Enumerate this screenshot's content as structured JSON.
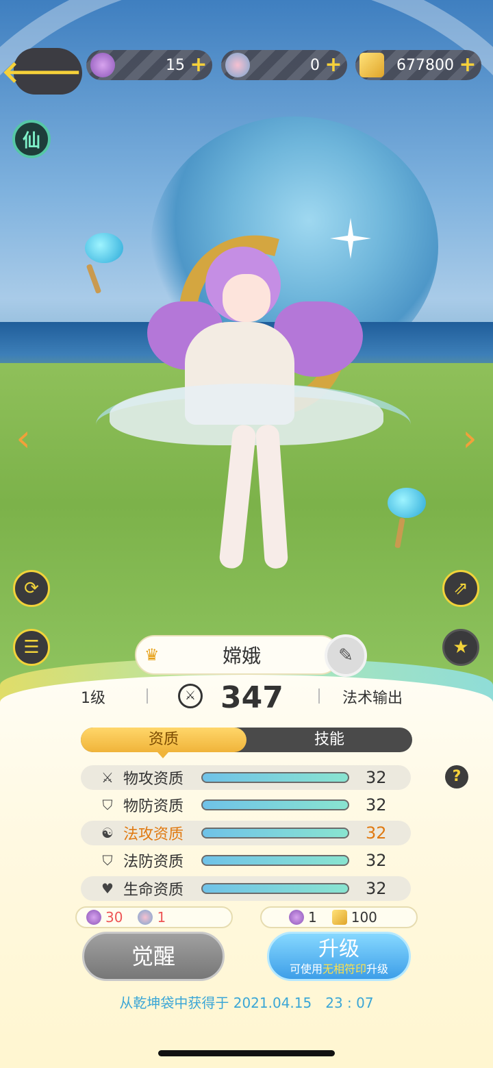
{
  "resources": [
    {
      "icon": "purple-character-icon",
      "value": "15"
    },
    {
      "icon": "gem-orb-icon",
      "value": "0"
    },
    {
      "icon": "gold-ingot-icon",
      "value": "677800"
    }
  ],
  "side": {
    "xian_label": "仙"
  },
  "character": {
    "name": "嫦娥",
    "level": "1级",
    "power": "347",
    "role": "法术输出"
  },
  "tabs": [
    {
      "label": "资质",
      "active": true
    },
    {
      "label": "技能",
      "active": false
    }
  ],
  "attributes": [
    {
      "icon": "crossed-swords-icon",
      "label": "物攻资质",
      "value": "32",
      "fill": 1.0
    },
    {
      "icon": "shield-icon",
      "label": "物防资质",
      "value": "32",
      "fill": 1.0
    },
    {
      "icon": "yin-yang-icon",
      "label": "法攻资质",
      "value": "32",
      "fill": 1.0,
      "highlight": true
    },
    {
      "icon": "magic-shield-icon",
      "label": "法防资质",
      "value": "32",
      "fill": 1.0
    },
    {
      "icon": "heart-icon",
      "label": "生命资质",
      "value": "32",
      "fill": 1.0
    }
  ],
  "awaken_cost": [
    {
      "icon": "character-token-icon",
      "value": "30"
    },
    {
      "icon": "gem-token-icon",
      "value": "1"
    }
  ],
  "upgrade_cost": [
    {
      "icon": "character-token-icon",
      "value": "1"
    },
    {
      "icon": "gold-ingot-icon",
      "value": "100"
    }
  ],
  "buttons": {
    "awaken": "觉醒",
    "upgrade": "升级",
    "upgrade_sub_pre": "可使用",
    "upgrade_sub_hl": "无相符印",
    "upgrade_sub_post": "升级"
  },
  "source": "从乾坤袋中获得于 2021.04.15　23 : 07",
  "colors": {
    "accent_gold": "#f6d13a",
    "highlight_orange": "#e07a12",
    "link_blue": "#3aa6d6"
  }
}
